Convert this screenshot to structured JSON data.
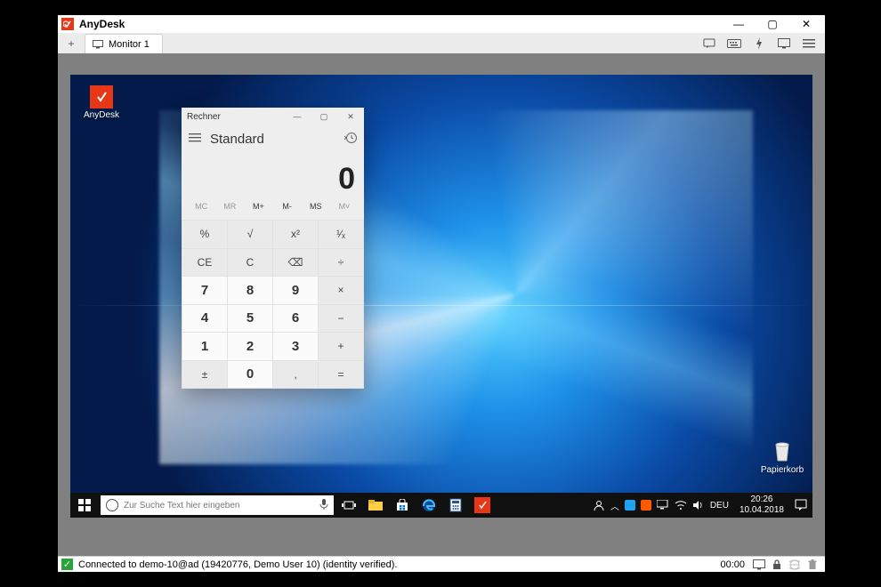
{
  "window": {
    "title": "AnyDesk",
    "tab_label": "Monitor 1"
  },
  "desktop_icons": {
    "anydesk": "AnyDesk",
    "papierkorb": "Papierkorb"
  },
  "calc": {
    "title": "Rechner",
    "mode": "Standard",
    "display": "0",
    "mem": {
      "mc": "MC",
      "mr": "MR",
      "mplus": "M+",
      "mminus": "M-",
      "ms": "MS",
      "mlist": "M˅"
    },
    "btn": {
      "percent": "%",
      "sqrt": "√",
      "sq": "x²",
      "recip": "¹∕ₓ",
      "ce": "CE",
      "c": "C",
      "back": "⌫",
      "div": "÷",
      "7": "7",
      "8": "8",
      "9": "9",
      "mul": "×",
      "4": "4",
      "5": "5",
      "6": "6",
      "minus": "−",
      "1": "1",
      "2": "2",
      "3": "3",
      "plus": "+",
      "neg": "±",
      "0": "0",
      "dec": ",",
      "eq": "="
    }
  },
  "remote_taskbar": {
    "search_placeholder": "Zur Suche Text hier eingeben",
    "lang": "DEU",
    "time": "20:26",
    "date": "10.04.2018"
  },
  "statusbar": {
    "text": "Connected to demo-10@ad (19420776, Demo User 10) (identity verified).",
    "timer": "00:00"
  }
}
